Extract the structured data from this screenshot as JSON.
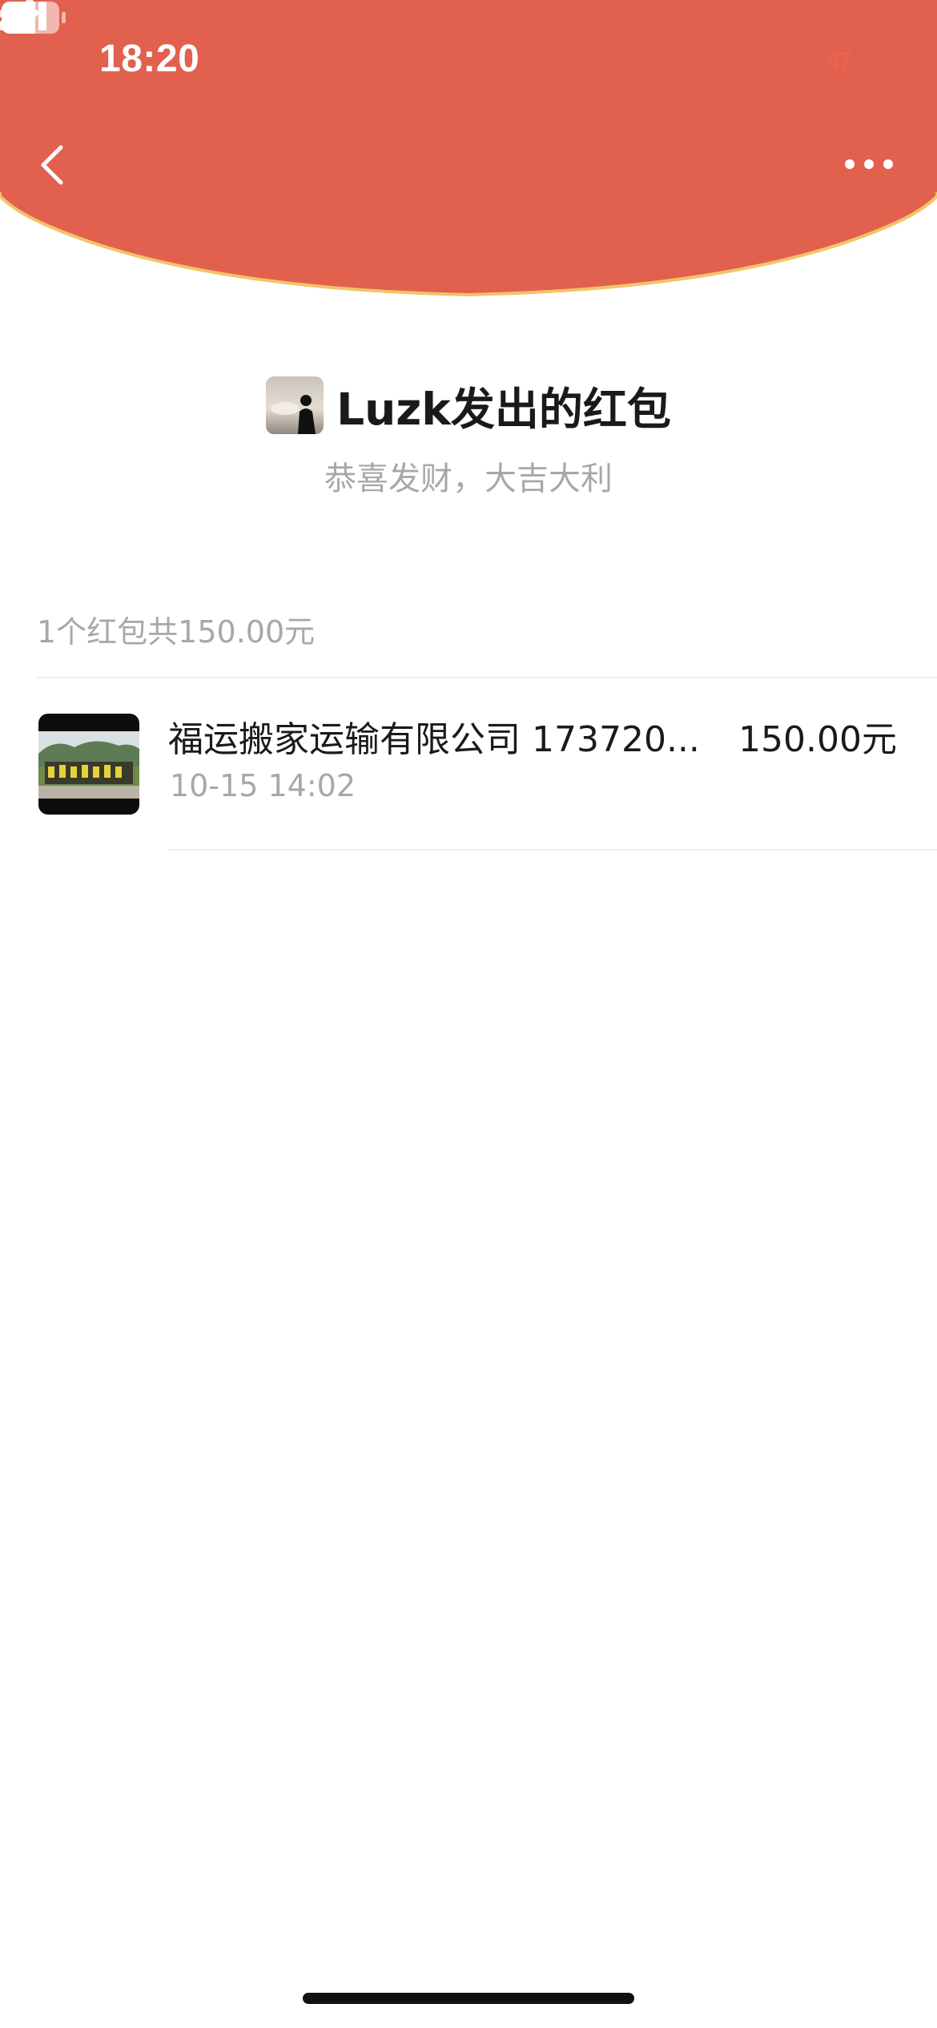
{
  "status_bar": {
    "time": "18:20",
    "battery_level": "47",
    "icons": [
      "signal-icon",
      "wifi-icon",
      "battery-icon"
    ]
  },
  "nav": {
    "back_icon": "chevron-left-icon",
    "more_icon": "more-dots-icon"
  },
  "theme": {
    "header_red": "#e2604e",
    "header_edge": "#f2c46a",
    "secondary_text": "#a8a8a8"
  },
  "sender": {
    "title": "Luzk发出的红包",
    "blessing": "恭喜发财，大吉大利"
  },
  "summary": {
    "text": "1个红包共150.00元"
  },
  "records": [
    {
      "name": "福运搬家运输有限公司 173720...",
      "amount": "150.00元",
      "time": "10-15 14:02"
    }
  ]
}
